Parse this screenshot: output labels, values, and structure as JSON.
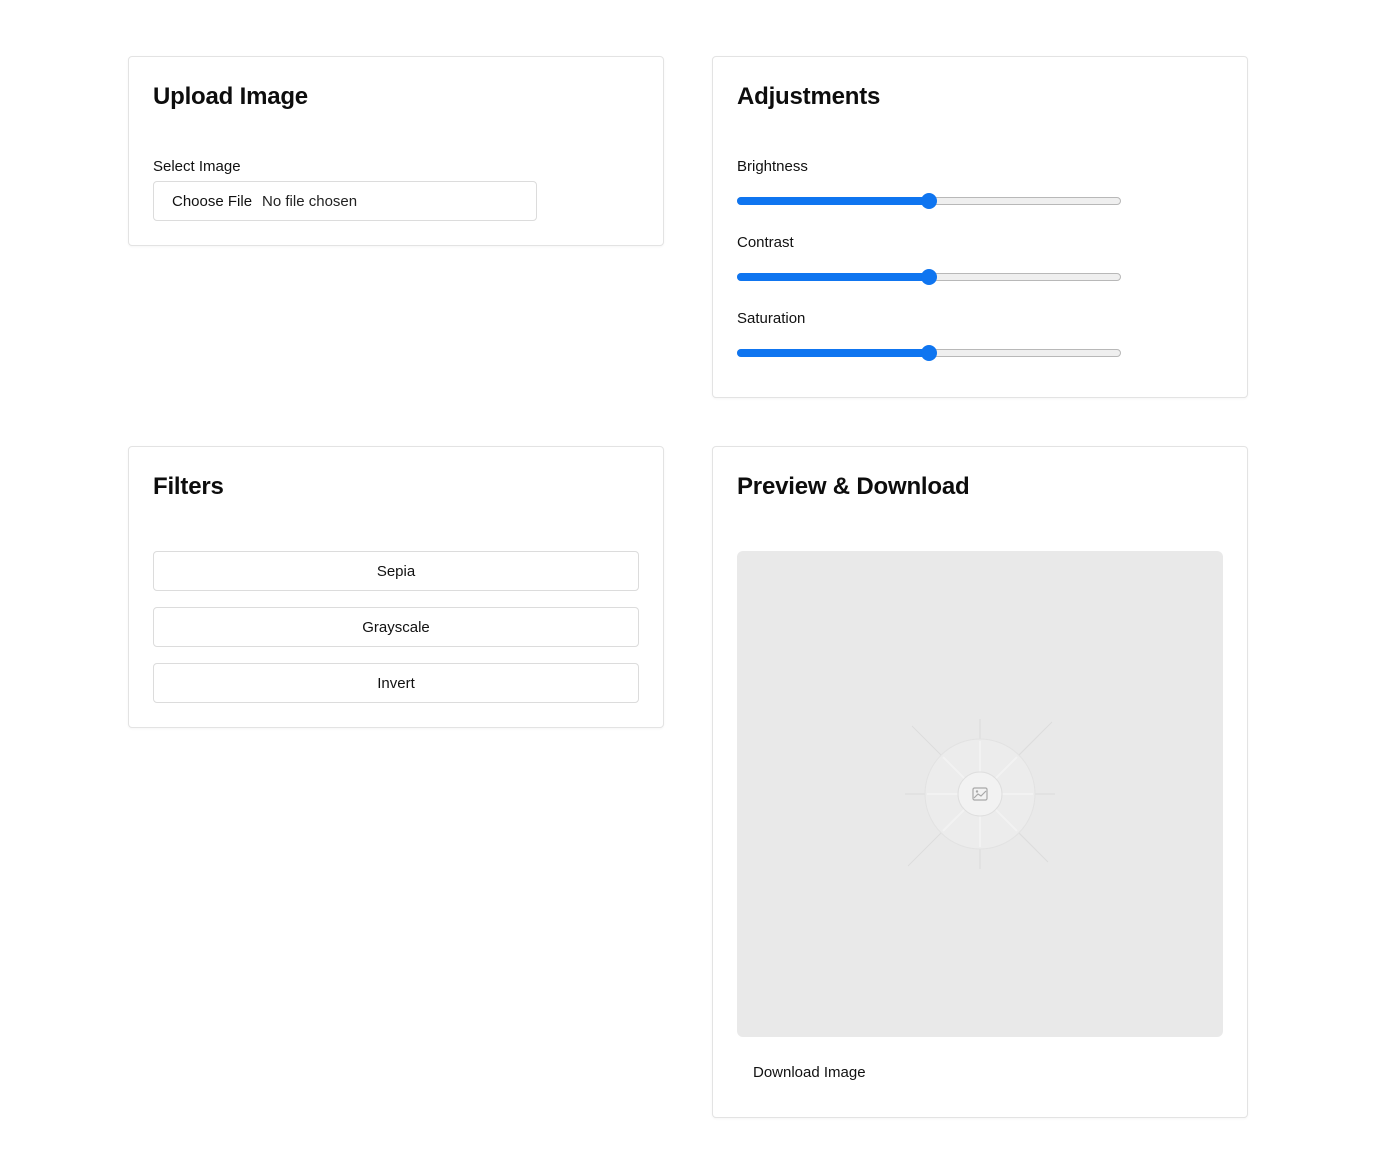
{
  "upload": {
    "title": "Upload Image",
    "select_label": "Select Image",
    "choose_file_label": "Choose File",
    "file_status": "No file chosen"
  },
  "adjustments": {
    "title": "Adjustments",
    "sliders": [
      {
        "label": "Brightness",
        "value": 0.5
      },
      {
        "label": "Contrast",
        "value": 0.5
      },
      {
        "label": "Saturation",
        "value": 0.5
      }
    ]
  },
  "filters": {
    "title": "Filters",
    "buttons": [
      "Sepia",
      "Grayscale",
      "Invert"
    ]
  },
  "preview": {
    "title": "Preview & Download",
    "placeholder_icon": "image-icon",
    "download_label": "Download Image"
  },
  "colors": {
    "accent": "#0f75f0",
    "preview_bg": "#e9e9e9",
    "card_border": "#e3e3e3"
  }
}
